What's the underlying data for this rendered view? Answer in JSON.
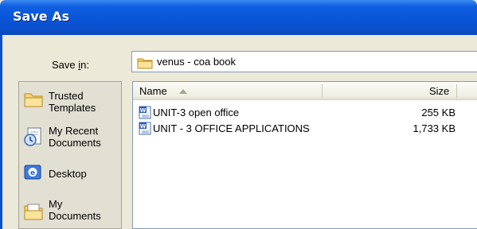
{
  "window": {
    "title": "Save As"
  },
  "savein": {
    "label_pre": "Save ",
    "label_key": "i",
    "label_post": "n:",
    "value": "venus - coa book"
  },
  "places": [
    {
      "label_line1": "Trusted",
      "label_line2": "Templates",
      "icon": "folder-icon"
    },
    {
      "label_line1": "My Recent",
      "label_line2": "Documents",
      "icon": "recent-documents-icon"
    },
    {
      "label_line1": "Desktop",
      "label_line2": "",
      "icon": "desktop-icon"
    },
    {
      "label_line1": "My",
      "label_line2": "Documents",
      "icon": "my-documents-icon"
    }
  ],
  "filelist": {
    "columns": {
      "name": "Name",
      "size": "Size"
    },
    "rows": [
      {
        "name": "UNIT-3 open office",
        "size": "255 KB",
        "icon": "word-document-icon"
      },
      {
        "name": "UNIT - 3 OFFICE APPLICATIONS",
        "size": "1,733 KB",
        "icon": "word-document-icon"
      }
    ]
  },
  "colors": {
    "titlebar": "#0a55d8",
    "dialog_bg": "#ece9d8",
    "field_border": "#7f9db9"
  }
}
